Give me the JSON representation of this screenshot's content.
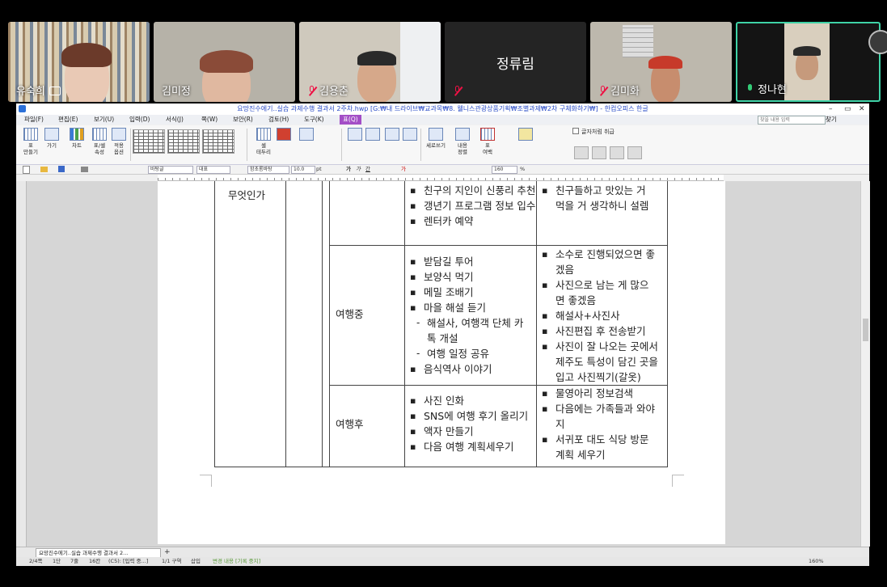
{
  "participants": [
    {
      "name": "유숙희",
      "mic": "muted",
      "camera_icon": true
    },
    {
      "name": "김미정",
      "mic": "none"
    },
    {
      "name": "김용춘",
      "mic": "muted"
    },
    {
      "name": "정류림",
      "mic": "muted",
      "video": "off"
    },
    {
      "name": "김미화",
      "mic": "muted"
    },
    {
      "name": "정나현",
      "mic": "on",
      "active_speaker": true
    }
  ],
  "window": {
    "title": "요망진수에기..실습 과제수행 결과서 2주차.hwp [G:₩내 드라이브₩교과목₩8. 웰니스관광상품기획₩조별과제₩2차 구체화하기₩] - 한컴오피스 한글",
    "controls": {
      "minimize": "–",
      "restore": "▭",
      "close": "✕"
    }
  },
  "menu": {
    "items": [
      "파일(F)",
      "편집(E)",
      "보기(U)",
      "입력(D)",
      "서식(J)",
      "쪽(W)",
      "보안(R)",
      "검토(H)",
      "도구(K)"
    ],
    "active": "표(Q)",
    "find_placeholder": "찾을 내용 입력",
    "find_label": "찾기"
  },
  "ribbon": {
    "groups": [
      {
        "label": "표\n만들기"
      },
      {
        "label": "가기"
      },
      {
        "label": "차트"
      },
      {
        "label": "표/셀\n속성"
      },
      {
        "label": "적용\n옵션"
      },
      {
        "label": "셀\n테두리"
      },
      {
        "label": "세로쓰기"
      },
      {
        "label": "내용\n정렬"
      },
      {
        "label": "표\n여백"
      }
    ],
    "checkbox_label": "글자처럼 취급"
  },
  "format_bar": {
    "style": "바탕글",
    "lang": "대표",
    "font": "함초롬바탕",
    "size": "10.0",
    "size_unit": "pt",
    "zoom": "160",
    "zoom_unit": "%"
  },
  "table": {
    "question_fragment": "무엇인가",
    "rows": [
      {
        "phase": "",
        "activities": [
          {
            "text": "친구의 지인이 신풍리 추천",
            "type": "bullet"
          },
          {
            "text": "갱년기 프로그램 정보 입수",
            "type": "bullet"
          },
          {
            "text": "렌터카 예약",
            "type": "bullet"
          }
        ],
        "feelings": [
          {
            "lines": [
              "친구들하고  맛있는  거",
              "먹을 거 생각하니 설렘"
            ]
          }
        ]
      },
      {
        "phase": "여행중",
        "activities": [
          {
            "text": "받담길 투어",
            "type": "bullet"
          },
          {
            "text": "보양식 먹기",
            "type": "bullet"
          },
          {
            "text": "메밀 조배기",
            "type": "bullet"
          },
          {
            "text": "마을 해설 듣기",
            "type": "bullet"
          },
          {
            "text": "해설사, 여행객 단체 카",
            "type": "dash"
          },
          {
            "text": "톡 개설",
            "type": "cont"
          },
          {
            "text": "여행 일정 공유",
            "type": "dash"
          },
          {
            "text": "음식역사 이야기",
            "type": "bullet"
          }
        ],
        "feelings": [
          {
            "lines": [
              "소수로 진행되었으면 좋",
              "겠음"
            ]
          },
          {
            "lines": [
              "사진으로  남는  게  많으",
              "면 좋겠음"
            ]
          },
          {
            "lines": [
              "해설사+사진사"
            ]
          },
          {
            "lines": [
              "사진편집 후 전송받기"
            ]
          },
          {
            "lines": [
              "사진이 잘 나오는 곳에서",
              "제주도 특성이 담긴 곳을",
              "입고 사진찍기(갈옷)"
            ]
          }
        ]
      },
      {
        "phase": "여행후",
        "activities": [
          {
            "text": "사진 인화",
            "type": "bullet"
          },
          {
            "text": "SNS에 여행 후기 올리기",
            "type": "bullet"
          },
          {
            "text": "액자 만들기",
            "type": "bullet"
          },
          {
            "text": "다음 여행 계획세우기",
            "type": "bullet"
          }
        ],
        "feelings": [
          {
            "lines": [
              "물영아리 정보검색"
            ]
          },
          {
            "lines": [
              "다음에는  가족들과  와야",
              "지"
            ]
          },
          {
            "lines": [
              "서귀포  대도  식당  방문",
              "계획 세우기"
            ]
          }
        ]
      }
    ]
  },
  "tabs": {
    "doc_tab": "요망진수에기..실습 과제수행 결과서 2...",
    "add": "+"
  },
  "status": {
    "page": "2/4쪽",
    "section": "1단",
    "line": "7줄",
    "col": "16칸",
    "cell": "(C5): [입력 중...]",
    "area": "1/1 구역",
    "mode": "삽입",
    "track": "변경 내용 [기록 중지]",
    "zoom": "160%"
  },
  "colors": {
    "accent_tab": "#a34ec6",
    "active_speaker_border": "#3fd2a6",
    "muted_mic": "#e11144"
  }
}
